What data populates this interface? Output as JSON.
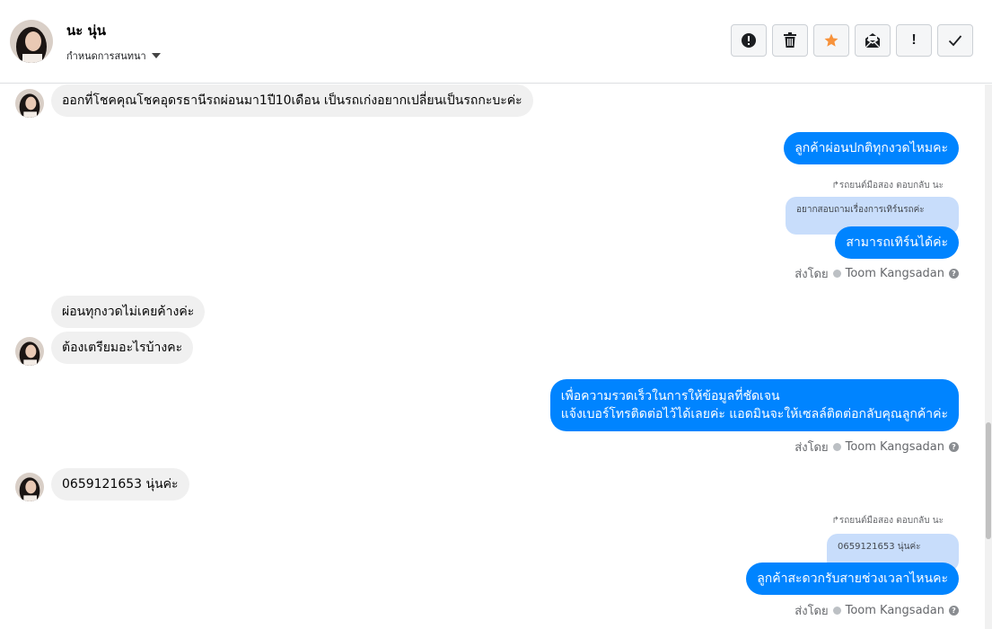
{
  "header": {
    "name": "นะ นุ่น",
    "assign_label": "กำหนดการสนทนา",
    "toolbar": [
      {
        "icon": "alert-circle-icon"
      },
      {
        "icon": "trash-icon"
      },
      {
        "icon": "star-icon",
        "color": "#f7923b"
      },
      {
        "icon": "envelope-icon"
      },
      {
        "icon": "exclamation-icon",
        "label": "!"
      },
      {
        "icon": "check-icon"
      }
    ]
  },
  "messages": {
    "m1": "ออกที่โชคคุณโชคอุดรธานีรถผ่อนมา1ปี10เดือน เป็นรถเก่งอยากเปลี่ยนเป็นรถกะบะค่ะ",
    "m2": "ลูกค้าผ่อนปกติทุกงวดไหมคะ",
    "r1_label": "รถยนต์มือสอง ตอบกลับ นะ",
    "r1_quote": "อยากสอบถามเรื่องการเทิร์นรถค่ะ",
    "m3": "สามารถเทิร์นได้ค่ะ",
    "sent_by_1": "ส่งโดย",
    "sender_1": "Toom Kangsadan",
    "m4": "ผ่อนทุกงวดไม่เคยค้างค่ะ",
    "m5": "ต้องเตรียมอะไรบ้างคะ",
    "m6_line1": "เพื่อความรวดเร็วในการให้ข้อมูลที่ชัดเจน",
    "m6_line2": "แจ้งเบอร์โทรติดต่อไว้ได้เลยค่ะ แอดมินจะให้เซลล์ติดต่อกลับคุณลูกค้าค่ะ",
    "sent_by_2": "ส่งโดย",
    "sender_2": "Toom Kangsadan",
    "m7": "0659121653 นุ่นค่ะ",
    "r2_label": "รถยนต์มือสอง ตอบกลับ นะ",
    "r2_quote": "0659121653 นุ่นค่ะ",
    "m8": "ลูกค้าสะดวกรับสายช่วงเวลาไหนคะ",
    "sent_by_3": "ส่งโดย",
    "sender_3": "Toom Kangsadan"
  },
  "colors": {
    "outgoing": "#0084ff",
    "incoming": "#f0f0f0",
    "quote": "#c8ddfb"
  }
}
